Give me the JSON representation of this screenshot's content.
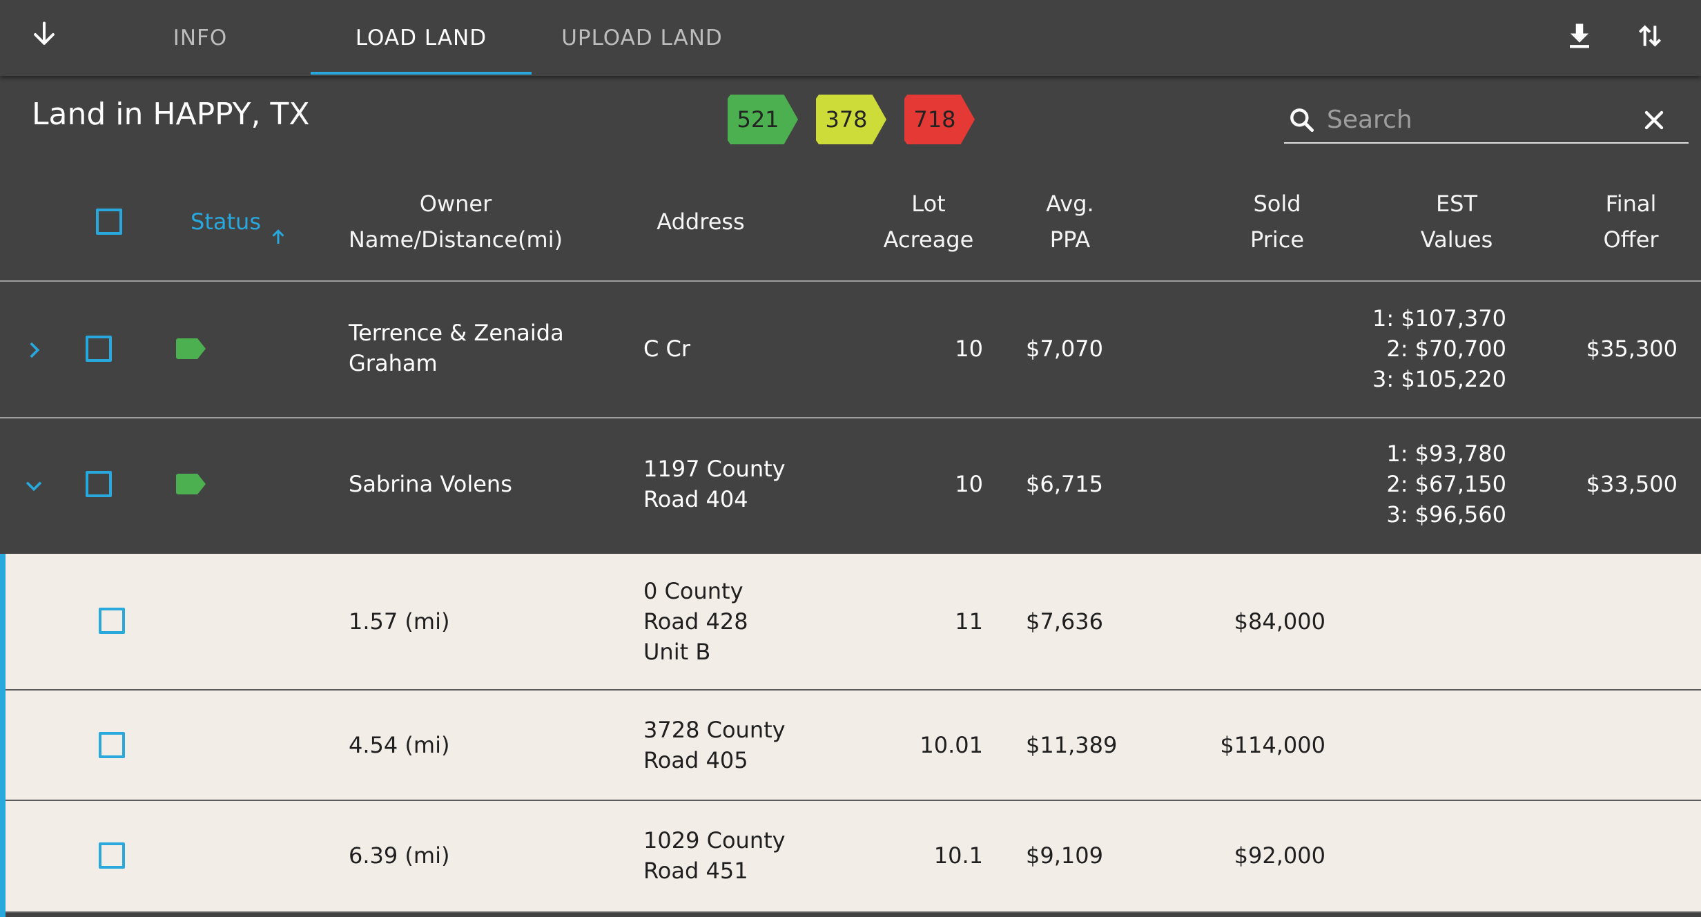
{
  "nav": {
    "tabs": [
      {
        "label": "INFO"
      },
      {
        "label": "LOAD LAND"
      },
      {
        "label": "UPLOAD LAND"
      }
    ],
    "active_tab": "LOAD LAND"
  },
  "header": {
    "title": "Land in HAPPY, TX",
    "badges": [
      {
        "value": "521",
        "color": "#4caf50"
      },
      {
        "value": "378",
        "color": "#cddc39"
      },
      {
        "value": "718",
        "color": "#e53935"
      }
    ]
  },
  "search": {
    "placeholder": "Search",
    "value": ""
  },
  "colors": {
    "accent": "#29a8dd",
    "status_green": "#4caf50",
    "dark_bg": "#424242",
    "light_row": "#f3ede7"
  },
  "table": {
    "columns": {
      "status": "Status",
      "owner": "Owner\nName/Distance(mi)",
      "address": "Address",
      "acreage": "Lot\nAcreage",
      "ppa": "Avg.\nPPA",
      "sold": "Sold\nPrice",
      "est": "EST\nValues",
      "offer": "Final\nOffer"
    },
    "sort": {
      "column": "Status",
      "direction": "ascending"
    },
    "rows": [
      {
        "expanded": false,
        "owner": "Terrence & Zenaida\nGraham",
        "address": "C Cr",
        "acreage": "10",
        "ppa": "$7,070",
        "sold": "",
        "est": "1: $107,370\n2: $70,700\n3: $105,220",
        "offer": "$35,300"
      },
      {
        "expanded": true,
        "owner": "Sabrina Volens",
        "address": "1197 County\nRoad 404",
        "acreage": "10",
        "ppa": "$6,715",
        "sold": "",
        "est": "1: $93,780\n2: $67,150\n3: $96,560",
        "offer": "$33,500"
      }
    ],
    "comps": [
      {
        "distance": "1.57 (mi)",
        "address": "0 County\nRoad 428\nUnit B",
        "acreage": "11",
        "ppa": "$7,636",
        "sold": "$84,000"
      },
      {
        "distance": "4.54 (mi)",
        "address": "3728 County\nRoad 405",
        "acreage": "10.01",
        "ppa": "$11,389",
        "sold": "$114,000"
      },
      {
        "distance": "6.39 (mi)",
        "address": "1029 County\nRoad 451",
        "acreage": "10.1",
        "ppa": "$9,109",
        "sold": "$92,000"
      }
    ]
  }
}
